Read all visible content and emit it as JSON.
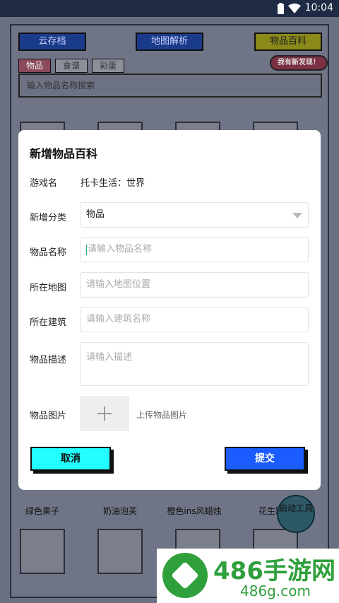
{
  "status": {
    "time": "10:04"
  },
  "background": {
    "top_buttons": {
      "cloud": "云存档",
      "map": "地图解析",
      "items": "物品百科"
    },
    "tabs": [
      "物品",
      "食谱",
      "彩蛋"
    ],
    "badge": "我有新发现！",
    "search_placeholder": "输入物品名称搜索",
    "item_labels": [
      "绿色果子",
      "奶油泡芙",
      "橙色ins风蜡烛",
      "花生罐头"
    ],
    "fab_label": "启动工具"
  },
  "dialog": {
    "title": "新增物品百科",
    "game_label": "游戏名",
    "game_value": "托卡生活：世界",
    "category_label": "新增分类",
    "category_value": "物品",
    "name_label": "物品名称",
    "name_placeholder": "请输入物品名称",
    "map_label": "所在地图",
    "map_placeholder": "请输入地图位置",
    "building_label": "所在建筑",
    "building_placeholder": "请输入建筑名称",
    "desc_label": "物品描述",
    "desc_placeholder": "请输入描述",
    "image_label": "物品图片",
    "upload_hint": "上传物品图片",
    "cancel_label": "取消",
    "submit_label": "提交"
  },
  "watermark": {
    "brand": "486手游网",
    "domain": "486g.com"
  }
}
